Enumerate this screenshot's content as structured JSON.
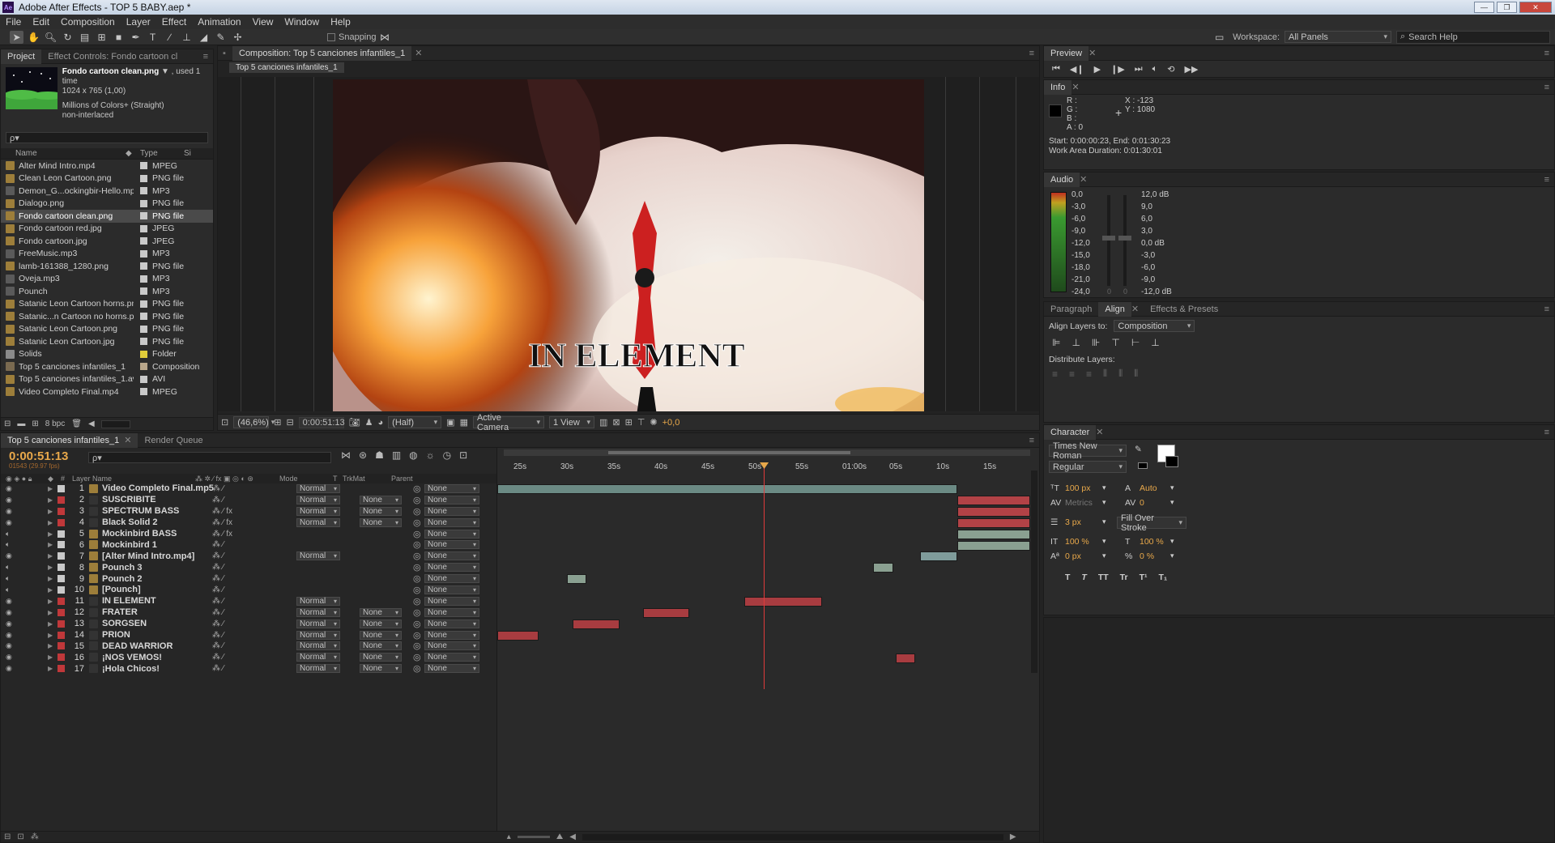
{
  "window": {
    "title": "Adobe After Effects - TOP 5 BABY.aep *",
    "app_icon": "Ae",
    "controls": [
      "—",
      "❐",
      "✕"
    ]
  },
  "menu": [
    "File",
    "Edit",
    "Composition",
    "Layer",
    "Effect",
    "Animation",
    "View",
    "Window",
    "Help"
  ],
  "toolbar": {
    "snapping_label": "Snapping",
    "workspace_label": "Workspace:",
    "workspace_value": "All Panels",
    "search_placeholder": "Search Help"
  },
  "project_panel": {
    "tab_project": "Project",
    "tab_effect_controls": "Effect Controls: Fondo cartoon cl",
    "preview_name": "Fondo cartoon clean.png",
    "preview_used": "▼ , used 1 time",
    "preview_dims": "1024 x 765 (1,00)",
    "preview_colors": "Millions of Colors+ (Straight)",
    "preview_interlace": "non-interlaced",
    "search_placeholder": "ρ▾",
    "col_name": "Name",
    "col_type": "Type",
    "col_size": "Si",
    "bpc": "8 bpc",
    "items": [
      {
        "name": "Alter Mind Intro.mp4",
        "type": "MPEG",
        "color": "#c9c9c9",
        "icon": "video-icon"
      },
      {
        "name": "Clean Leon Cartoon.png",
        "type": "PNG file",
        "color": "#c9c9c9",
        "icon": "image-icon"
      },
      {
        "name": "Demon_G...ockingbir-Hello.mp3",
        "type": "MP3",
        "color": "#c9c9c9",
        "icon": "audio-icon"
      },
      {
        "name": "Dialogo.png",
        "type": "PNG file",
        "color": "#c9c9c9",
        "icon": "image-icon"
      },
      {
        "name": "Fondo cartoon clean.png",
        "type": "PNG file",
        "color": "#c9c9c9",
        "icon": "image-icon",
        "selected": true
      },
      {
        "name": "Fondo cartoon red.jpg",
        "type": "JPEG",
        "color": "#c9c9c9",
        "icon": "image-icon"
      },
      {
        "name": "Fondo cartoon.jpg",
        "type": "JPEG",
        "color": "#c9c9c9",
        "icon": "image-icon"
      },
      {
        "name": "FreeMusic.mp3",
        "type": "MP3",
        "color": "#c9c9c9",
        "icon": "audio-icon"
      },
      {
        "name": "lamb-161388_1280.png",
        "type": "PNG file",
        "color": "#c9c9c9",
        "icon": "image-icon"
      },
      {
        "name": "Oveja.mp3",
        "type": "MP3",
        "color": "#c9c9c9",
        "icon": "audio-icon"
      },
      {
        "name": "Pounch",
        "type": "MP3",
        "color": "#c9c9c9",
        "icon": "audio-icon"
      },
      {
        "name": "Satanic Leon Cartoon horns.png",
        "type": "PNG file",
        "color": "#c9c9c9",
        "icon": "image-icon"
      },
      {
        "name": "Satanic...n Cartoon no horns.png",
        "type": "PNG file",
        "color": "#c9c9c9",
        "icon": "image-icon"
      },
      {
        "name": "Satanic Leon Cartoon.png",
        "type": "PNG file",
        "color": "#c9c9c9",
        "icon": "image-icon"
      },
      {
        "name": "Satanic Leon Cartoon.jpg",
        "type": "PNG file",
        "color": "#c9c9c9",
        "icon": "image-icon"
      },
      {
        "name": "Solids",
        "type": "Folder",
        "color": "#e0cc3a",
        "icon": "folder-icon"
      },
      {
        "name": "Top 5 canciones infantiles_1",
        "type": "Composition",
        "color": "#b8a68a",
        "icon": "composition-icon"
      },
      {
        "name": "Top 5 canciones infantiles_1.avi",
        "type": "AVI",
        "color": "#c9c9c9",
        "icon": "video-icon"
      },
      {
        "name": "Video Completo Final.mp4",
        "type": "MPEG",
        "color": "#c9c9c9",
        "icon": "video-icon"
      }
    ]
  },
  "composition_panel": {
    "tab": "Composition: Top 5 canciones infantiles_1",
    "subtab": "Top 5 canciones infantiles_1",
    "overlay_text": "IN ELEMENT",
    "zoom": "(46,6%)",
    "timecode": "0:00:51:13",
    "resolution": "(Half)",
    "camera": "Active Camera",
    "views": "1 View",
    "exposure": "+0,0"
  },
  "preview_panel": {
    "tab": "Preview"
  },
  "info_panel": {
    "tab": "Info",
    "r": "R :",
    "g": "G :",
    "b": "B :",
    "a": "A : 0",
    "x": "X : -123",
    "y": "Y : 1080",
    "start_end": "Start: 0:00:00:23, End: 0:01:30:23",
    "work_area": "Work Area Duration: 0:01:30:01"
  },
  "audio_panel": {
    "tab": "Audio",
    "left_scale": [
      "0,0",
      "-3,0",
      "-6,0",
      "-9,0",
      "-12,0",
      "-15,0",
      "-18,0",
      "-21,0",
      "-24,0"
    ],
    "right_scale": [
      "12,0 dB",
      "9,0",
      "6,0",
      "3,0",
      "0,0 dB",
      "-3,0",
      "-6,0",
      "-9,0",
      "-12,0 dB"
    ],
    "slider_l": "0",
    "slider_r": "0"
  },
  "align_panel": {
    "tab_paragraph": "Paragraph",
    "tab_align": "Align",
    "tab_effects": "Effects & Presets",
    "align_to_label": "Align Layers to:",
    "align_to_value": "Composition",
    "distribute_label": "Distribute Layers:"
  },
  "character_panel": {
    "tab": "Character",
    "font": "Times New Roman",
    "style": "Regular",
    "size": "100 px",
    "leading": "Auto",
    "kerning": "Metrics",
    "tracking": "0",
    "stroke_width": "3 px",
    "stroke_mode": "Fill Over Stroke",
    "vscale": "100 %",
    "hscale": "100 %",
    "baseline": "0 px",
    "tsume": "0 %",
    "styles": [
      "T",
      "T",
      "TT",
      "Tr",
      "T¹",
      "T₁"
    ]
  },
  "timeline": {
    "tab": "Top 5 canciones infantiles_1",
    "tab_render": "Render Queue",
    "timecode": "0:00:51:13",
    "fps": "01543 (29.97 fps)",
    "search_placeholder": "ρ▾",
    "col_layer": "Layer Name",
    "col_mode": "Mode",
    "col_t": "T",
    "col_trkmat": "TrkMat",
    "col_parent": "Parent",
    "ruler": [
      "25s",
      "30s",
      "35s",
      "40s",
      "45s",
      "50s",
      "55s",
      "01:00s",
      "05s",
      "10s",
      "15s"
    ],
    "layers": [
      {
        "num": "1",
        "name": "Video Completo Final.mp5",
        "color": "#c9c9c9",
        "mode": "Normal",
        "trkmat": "",
        "parent": "None",
        "fx": false,
        "audio": false,
        "bar": {
          "start": 0.0,
          "end": 0.863,
          "color": "#6b8a84"
        }
      },
      {
        "num": "2",
        "name": "SUSCRIBITE",
        "color": "#c0383a",
        "mode": "Normal",
        "trkmat": "None",
        "parent": "None",
        "fx": false,
        "audio": false,
        "bar": {
          "start": 0.863,
          "end": 1.0,
          "color": "#b24246"
        }
      },
      {
        "num": "3",
        "name": "SPECTRUM BASS",
        "color": "#c0383a",
        "mode": "Normal",
        "trkmat": "None",
        "parent": "None",
        "fx": true,
        "audio": false,
        "bar": {
          "start": 0.863,
          "end": 1.0,
          "color": "#b24246"
        }
      },
      {
        "num": "4",
        "name": "Black Solid 2",
        "color": "#c0383a",
        "mode": "Normal",
        "trkmat": "None",
        "parent": "None",
        "fx": true,
        "audio": false,
        "bar": {
          "start": 0.863,
          "end": 1.0,
          "color": "#b24246"
        }
      },
      {
        "num": "5",
        "name": "Mockinbird BASS",
        "color": "#c9c9c9",
        "mode": "",
        "trkmat": "",
        "parent": "None",
        "fx": true,
        "audio": true,
        "bar": {
          "start": 0.863,
          "end": 1.0,
          "color": "#8aa091"
        }
      },
      {
        "num": "6",
        "name": "Mockinbird 1",
        "color": "#c9c9c9",
        "mode": "",
        "trkmat": "",
        "parent": "None",
        "fx": false,
        "audio": true,
        "bar": {
          "start": 0.863,
          "end": 1.0,
          "color": "#8aa091"
        }
      },
      {
        "num": "7",
        "name": "[Alter Mind Intro.mp4]",
        "color": "#c9c9c9",
        "mode": "Normal",
        "trkmat": "",
        "parent": "None",
        "fx": false,
        "audio": true,
        "bar": {
          "start": 0.794,
          "end": 0.863,
          "color": "#7f9c9b"
        }
      },
      {
        "num": "8",
        "name": "Pounch 3",
        "color": "#c9c9c9",
        "mode": "",
        "trkmat": "",
        "parent": "None",
        "fx": false,
        "audio": true,
        "bar": {
          "start": 0.705,
          "end": 0.743,
          "color": "#8aa091"
        }
      },
      {
        "num": "9",
        "name": "Pounch 2",
        "color": "#c9c9c9",
        "mode": "",
        "trkmat": "",
        "parent": "None",
        "fx": false,
        "audio": true,
        "bar": {
          "start": 0.131,
          "end": 0.167,
          "color": "#8aa091"
        }
      },
      {
        "num": "10",
        "name": "[Pounch]",
        "color": "#c9c9c9",
        "mode": "",
        "trkmat": "",
        "parent": "None",
        "fx": false,
        "audio": true,
        "bar": null
      },
      {
        "num": "11",
        "name": "IN ELEMENT",
        "color": "#c0383a",
        "mode": "Normal",
        "trkmat": "",
        "parent": "None",
        "fx": false,
        "audio": false,
        "bar": {
          "start": 0.463,
          "end": 0.61,
          "color": "#a83c40"
        }
      },
      {
        "num": "12",
        "name": "FRATER",
        "color": "#c0383a",
        "mode": "Normal",
        "trkmat": "None",
        "parent": "None",
        "fx": false,
        "audio": false,
        "bar": {
          "start": 0.273,
          "end": 0.36,
          "color": "#a83c40"
        }
      },
      {
        "num": "13",
        "name": "SORGSEN",
        "color": "#c0383a",
        "mode": "Normal",
        "trkmat": "None",
        "parent": "None",
        "fx": false,
        "audio": false,
        "bar": {
          "start": 0.142,
          "end": 0.229,
          "color": "#a83c40"
        }
      },
      {
        "num": "14",
        "name": "PRION",
        "color": "#c0383a",
        "mode": "Normal",
        "trkmat": "None",
        "parent": "None",
        "fx": false,
        "audio": false,
        "bar": {
          "start": 0.0,
          "end": 0.077,
          "color": "#a83c40"
        }
      },
      {
        "num": "15",
        "name": "DEAD WARRIOR",
        "color": "#c0383a",
        "mode": "Normal",
        "trkmat": "None",
        "parent": "None",
        "fx": false,
        "audio": false,
        "bar": null
      },
      {
        "num": "16",
        "name": "¡NOS VEMOS!",
        "color": "#c0383a",
        "mode": "Normal",
        "trkmat": "None",
        "parent": "None",
        "fx": false,
        "audio": false,
        "bar": {
          "start": 0.747,
          "end": 0.784,
          "color": "#a83c40"
        }
      },
      {
        "num": "17",
        "name": "¡Hola Chicos!",
        "color": "#c0383a",
        "mode": "Normal",
        "trkmat": "None",
        "parent": "None",
        "fx": false,
        "audio": false,
        "bar": null
      }
    ],
    "playhead_fraction": 0.494,
    "work_area": {
      "start": 0.199,
      "end": 0.659
    }
  },
  "colors": {
    "accent_time": "#e8a84a",
    "playhead": "#e03b3b",
    "panel_bg": "#2b2b2b"
  }
}
